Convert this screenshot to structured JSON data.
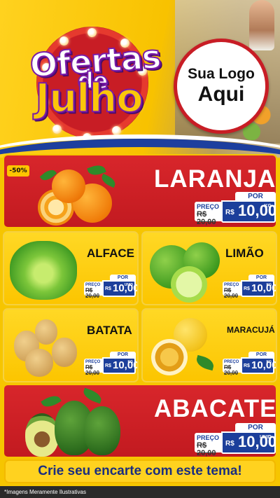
{
  "header": {
    "title_line1": "Ofertas",
    "title_line2": "de",
    "title_line3": "Julho",
    "logo_line1": "Sua Logo",
    "logo_line2": "Aqui"
  },
  "products": [
    {
      "name": "LARANJA",
      "badge": "-50%",
      "por": "POR",
      "preco_label": "PREÇO",
      "old_price": "R$ 20,00",
      "currency": "R$",
      "price": "10,00",
      "unit": "KG"
    },
    {
      "name": "ALFACE",
      "por": "POR",
      "preco_label": "PREÇO",
      "old_price": "R$ 20,00",
      "currency": "R$",
      "price": "10,00",
      "unit": "UNID"
    },
    {
      "name": "LIMÃO",
      "por": "POR",
      "preco_label": "PREÇO",
      "old_price": "R$ 20,00",
      "currency": "R$",
      "price": "10,00",
      "unit": "KG"
    },
    {
      "name": "BATATA",
      "por": "POR",
      "preco_label": "PREÇO",
      "old_price": "R$ 20,00",
      "currency": "R$",
      "price": "10,00",
      "unit": "KG"
    },
    {
      "name": "MARACUJÁ",
      "por": "POR",
      "preco_label": "PREÇO",
      "old_price": "R$ 20,00",
      "currency": "R$",
      "price": "10,00",
      "unit": "KG"
    },
    {
      "name": "ABACATE",
      "por": "POR",
      "preco_label": "PREÇO",
      "old_price": "R$ 20,00",
      "currency": "R$",
      "price": "10,00",
      "unit": "UNID"
    }
  ],
  "cta": "Crie seu encarte com este tema!",
  "disclaimer": "*Imagens Meramente Ilustrativas",
  "colors": {
    "red": "#c81d25",
    "yellow": "#f6c500",
    "blue": "#1c3f9b"
  }
}
